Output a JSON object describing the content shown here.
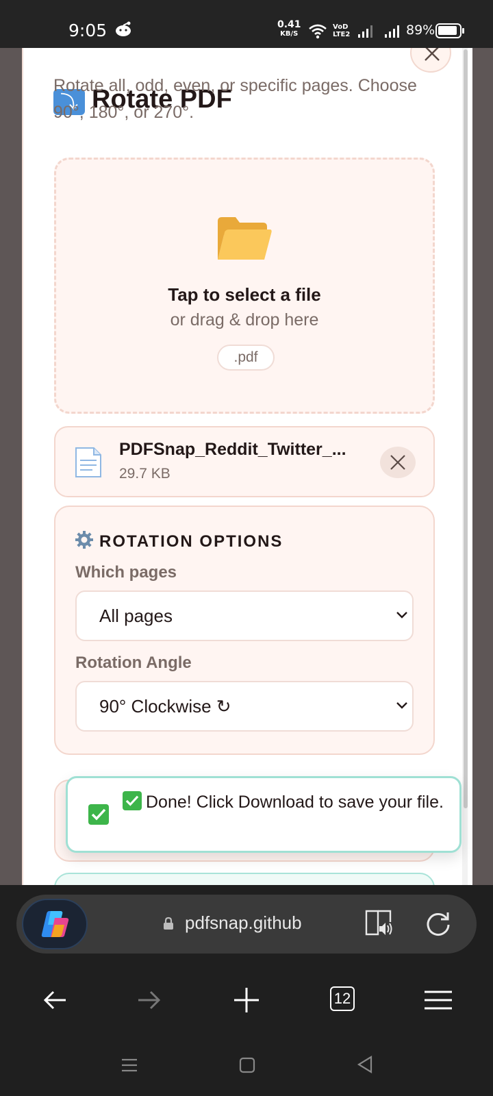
{
  "status_bar": {
    "time": "9:05",
    "speed_value": "0.41",
    "speed_unit": "KB/S",
    "network_label": "VoD LTE2",
    "battery": "89%"
  },
  "modal": {
    "title": "Rotate PDF",
    "subtitle": "Rotate all, odd, even, or specific pages. Choose 90°, 180°, or 270°."
  },
  "dropzone": {
    "title": "Tap to select a file",
    "subtitle": "or drag & drop here",
    "extension": ".pdf"
  },
  "file": {
    "name": "PDFSnap_Reddit_Twitter_...",
    "size": "29.7 KB"
  },
  "options": {
    "heading": "ROTATION OPTIONS",
    "pages_label": "Which pages",
    "pages_value": "All pages",
    "angle_label": "Rotation Angle",
    "angle_value": "90° Clockwise ↻"
  },
  "toast": {
    "message": "Done! Click Download to save your file."
  },
  "browser": {
    "url": "pdfsnap.github",
    "tab_count": "12"
  },
  "colors": {
    "accent_check": "#3db54a",
    "card_border": "#f3d6cd",
    "card_bg": "#fff5f2",
    "toast_border": "#9fe0d4"
  }
}
